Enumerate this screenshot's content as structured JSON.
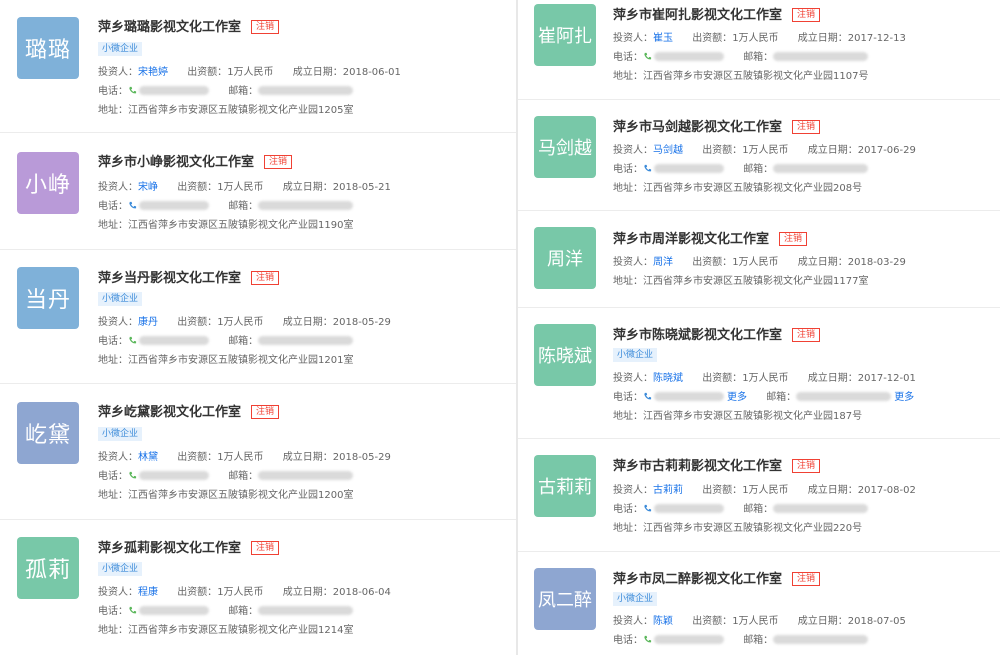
{
  "labels": {
    "investor": "投资人：",
    "capital": "出资额：",
    "founded": "成立日期：",
    "phone": "电话：",
    "email": "邮箱：",
    "address": "地址：",
    "more": "更多"
  },
  "colors": {
    "blue": "#7fb1d9",
    "purple": "#b99ad8",
    "slate": "#8ea6d1",
    "green": "#78c8a8",
    "status_red": "#f04134",
    "link_blue": "#1a73e8"
  },
  "left": [
    {
      "avatar": "璐璐",
      "color": "#7fb1d9",
      "name": "萍乡璐璐影视文化工作室",
      "status": "注销",
      "type": "小微企业",
      "investor": "宋艳婷",
      "capital": "1万人民币",
      "founded": "2018-06-01",
      "address": "江西省萍乡市安源区五陂镇影视文化产业园1205室"
    },
    {
      "avatar": "小峥",
      "color": "#b99ad8",
      "name": "萍乡市小峥影视文化工作室",
      "status": "注销",
      "type": "",
      "investor": "宋峥",
      "capital": "1万人民币",
      "founded": "2018-05-21",
      "address": "江西省萍乡市安源区五陂镇影视文化产业园1190室"
    },
    {
      "avatar": "当丹",
      "color": "#7fb1d9",
      "name": "萍乡当丹影视文化工作室",
      "status": "注销",
      "type": "小微企业",
      "investor": "康丹",
      "capital": "1万人民币",
      "founded": "2018-05-29",
      "address": "江西省萍乡市安源区五陂镇影视文化产业园1201室"
    },
    {
      "avatar": "屹黛",
      "color": "#8ea6d1",
      "name": "萍乡屹黛影视文化工作室",
      "status": "注销",
      "type": "小微企业",
      "investor": "林黛",
      "capital": "1万人民币",
      "founded": "2018-05-29",
      "address": "江西省萍乡市安源区五陂镇影视文化产业园1200室"
    },
    {
      "avatar": "孤莉",
      "color": "#78c8a8",
      "name": "萍乡孤莉影视文化工作室",
      "status": "注销",
      "type": "小微企业",
      "investor": "程康",
      "capital": "1万人民币",
      "founded": "2018-06-04",
      "address": "江西省萍乡市安源区五陂镇影视文化产业园1214室"
    }
  ],
  "right": [
    {
      "avatar": "崔阿扎",
      "color": "#78c8a8",
      "name": "萍乡市崔阿扎影视文化工作室",
      "status": "注销",
      "type": "",
      "investor": "崔玉",
      "capital": "1万人民币",
      "founded": "2017-12-13",
      "address": "江西省萍乡市安源区五陂镇影视文化产业园1107号",
      "more": false
    },
    {
      "avatar": "马剑越",
      "color": "#78c8a8",
      "name": "萍乡市马剑越影视文化工作室",
      "status": "注销",
      "type": "",
      "investor": "马剑越",
      "capital": "1万人民币",
      "founded": "2017-06-29",
      "address": "江西省萍乡市安源区五陂镇影视文化产业园208号",
      "more": false
    },
    {
      "avatar": "周洋",
      "color": "#78c8a8",
      "name": "萍乡市周洋影视文化工作室",
      "status": "注销",
      "type": "",
      "investor": "周洋",
      "capital": "1万人民币",
      "founded": "2018-03-29",
      "address": "江西省萍乡市安源区五陂镇影视文化产业园1177室",
      "more": false
    },
    {
      "avatar": "陈晓斌",
      "color": "#78c8a8",
      "name": "萍乡市陈晓斌影视文化工作室",
      "status": "注销",
      "type": "小微企业",
      "investor": "陈晓斌",
      "capital": "1万人民币",
      "founded": "2017-12-01",
      "address": "江西省萍乡市安源区五陂镇影视文化产业园187号",
      "more": true
    },
    {
      "avatar": "古莉莉",
      "color": "#78c8a8",
      "name": "萍乡市古莉莉影视文化工作室",
      "status": "注销",
      "type": "",
      "investor": "古莉莉",
      "capital": "1万人民币",
      "founded": "2017-08-02",
      "address": "江西省萍乡市安源区五陂镇影视文化产业园220号",
      "more": false
    },
    {
      "avatar": "凤二醉",
      "color": "#8ea6d1",
      "name": "萍乡市凤二醉影视文化工作室",
      "status": "注销",
      "type": "小微企业",
      "investor": "陈颖",
      "capital": "1万人民币",
      "founded": "2018-07-05",
      "address": "",
      "more": false
    }
  ]
}
